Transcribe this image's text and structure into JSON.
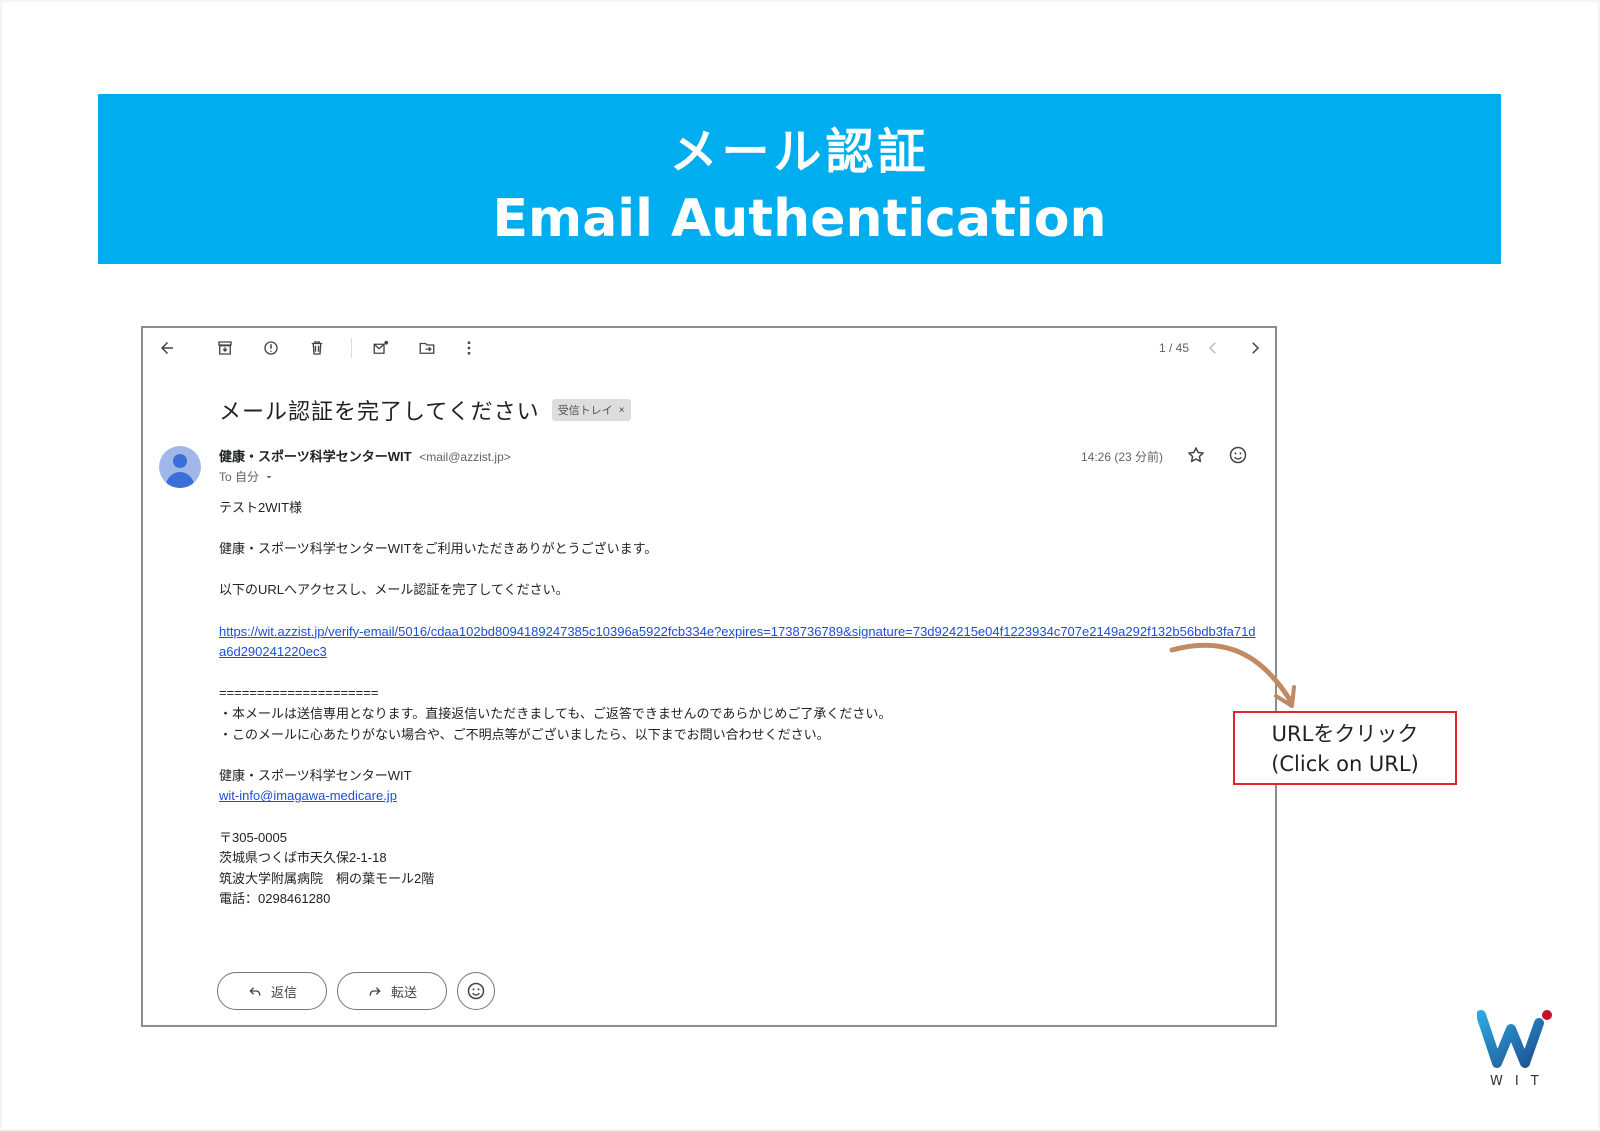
{
  "banner": {
    "title_jp": "メール認証",
    "title_en": "Email Authentication"
  },
  "toolbar": {
    "back_icon": "arrow-left-icon",
    "archive_icon": "archive-icon",
    "report_icon": "report-spam-icon",
    "delete_icon": "trash-icon",
    "mark_unread_icon": "mark-unread-icon",
    "move_icon": "move-to-icon",
    "more_icon": "more-vert-icon",
    "pager": "1 / 45"
  },
  "email": {
    "subject": "メール認証を完了してください",
    "label": "受信トレイ",
    "label_close": "×",
    "sender_name": "健康・スポーツ科学センターWIT",
    "sender_addr": "<mail@azzist.jp>",
    "to": "To 自分",
    "timestamp": "14:26 (23 分前)",
    "greeting": "テスト2WIT様",
    "thanks": "健康・スポーツ科学センターWITをご利用いただきありがとうございます。",
    "instruction": "以下のURLへアクセスし、メール認証を完了してください。",
    "verify_url": "https://wit.azzist.jp/verify-email/5016/cdaa102bd8094189247385c10396a5922fcb334e?expires=1738736789&signature=73d924215e04f1223934c707e2149a292f132b56bdb3fa71da6d290241220ec3",
    "divider": "=====================",
    "note1": "・本メールは送信専用となります。直接返信いただきましても、ご返答できませんのであらかじめご了承ください。",
    "note2": "・このメールに心あたりがない場合や、ご不明点等がございましたら、以下までお問い合わせください。",
    "sig_name": "健康・スポーツ科学センターWIT",
    "sig_email": "wit-info@imagawa-medicare.jp",
    "sig_postal": "〒305-0005",
    "sig_addr1": "茨城県つくば市天久保2-1-18",
    "sig_addr2": "筑波大学附属病院　桐の葉モール2階",
    "sig_phone": "電話：0298461280"
  },
  "actions": {
    "reply_label": "返信",
    "forward_label": "転送"
  },
  "callout": {
    "line1": "URLをクリック",
    "line2": "(Click on URL)",
    "border_color": "#e0262b"
  },
  "logo": {
    "text": "WIT"
  },
  "colors": {
    "banner": "#00adef",
    "link": "#1a4fd6",
    "arrow": "#c08a64"
  }
}
